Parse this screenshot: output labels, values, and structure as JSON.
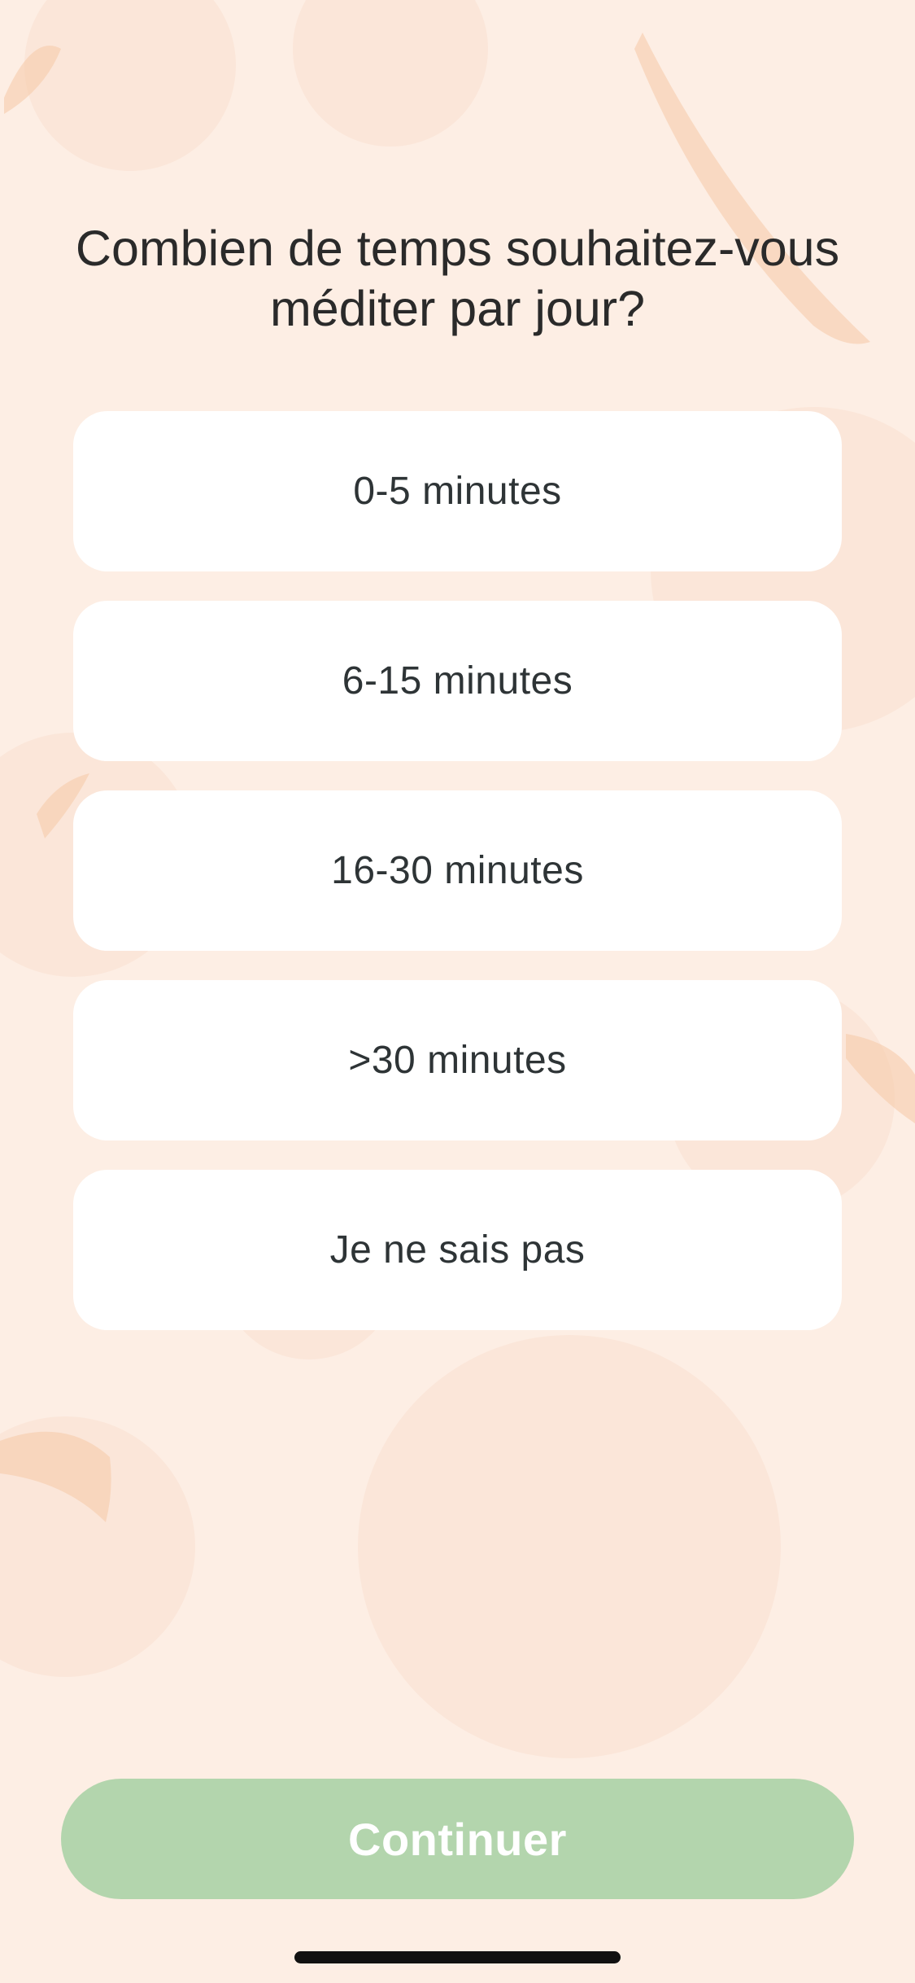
{
  "theme": {
    "background": "#fdeee4",
    "card": "#ffffff",
    "text": "#2a2a2a",
    "option_text": "#2e3436",
    "button_disabled": "#b3d5ad",
    "button_text": "#ffffff",
    "decor_accent": "#f6c9a6"
  },
  "question": {
    "title": "Combien de temps souhaitez-vous méditer par jour?"
  },
  "options": [
    {
      "label": "0-5 minutes"
    },
    {
      "label": "6-15 minutes"
    },
    {
      "label": "16-30 minutes"
    },
    {
      "label": ">30 minutes"
    },
    {
      "label": "Je ne sais pas"
    }
  ],
  "footer": {
    "continue_label": "Continuer"
  }
}
